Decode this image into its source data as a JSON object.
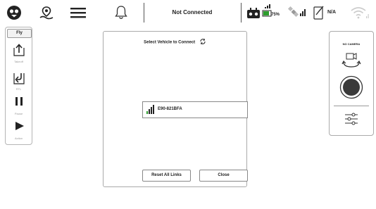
{
  "topbar": {
    "status_text": "Not Connected",
    "battery_percent": "75%",
    "na_text": "N/A"
  },
  "toolbar": {
    "heading": "Fly",
    "tools": [
      {
        "label": "Takeoff",
        "icon": "takeoff-icon"
      },
      {
        "label": "RTL",
        "icon": "rtl-icon"
      },
      {
        "label": "Pause",
        "icon": "pause-icon"
      },
      {
        "label": "Action",
        "icon": "play-icon"
      }
    ]
  },
  "dialog": {
    "title": "Select Vehicle to Connect",
    "vehicle_name": "E90-821BFA",
    "reset_label": "Reset All Links",
    "close_label": "Close"
  },
  "camera": {
    "title": "NO CAMERA"
  },
  "colors": {
    "battery_green": "#2e9e2e",
    "border_gray": "#aaaaaa",
    "icon_gray": "#bbbbbb"
  }
}
